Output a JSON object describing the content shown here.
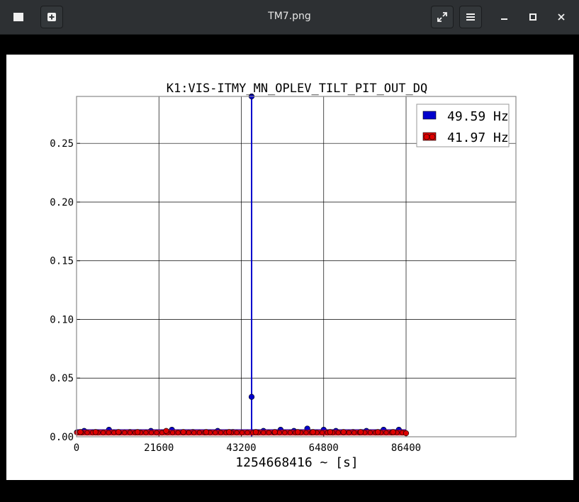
{
  "window": {
    "title": "TM7.png",
    "icons": {
      "left_1": "image-icon",
      "left_2": "add-icon",
      "fullscreen": "fullscreen-icon",
      "menu": "hamburger-menu-icon",
      "minimize": "minimize-icon",
      "maximize": "maximize-icon",
      "close": "close-icon"
    }
  },
  "chart_data": {
    "type": "scatter",
    "title": "K1:VIS-ITMY_MN_OPLEV_TILT_PIT_OUT_DQ",
    "xlabel": "1254668416 ~ [s]",
    "ylabel": "",
    "xlim": [
      0,
      115200
    ],
    "ylim": [
      0,
      0.29
    ],
    "xticks": [
      0,
      21600,
      43200,
      64800,
      86400
    ],
    "xtick_labels": [
      "0",
      "21600",
      "43200",
      "64800",
      "86400"
    ],
    "yticks": [
      0.0,
      0.05,
      0.1,
      0.15,
      0.2,
      0.25
    ],
    "ytick_labels": [
      "0.00",
      "0.05",
      "0.10",
      "0.15",
      "0.20",
      "0.25"
    ],
    "grid": true,
    "legend_position": "top-right",
    "series": [
      {
        "name": "49.59 Hz",
        "color": "#0000cc",
        "marker": "circle",
        "spike": {
          "x": 45900,
          "values": [
            0.29,
            0.034
          ]
        },
        "x_range": [
          0,
          86400
        ],
        "points": [
          [
            2000,
            0.005
          ],
          [
            8500,
            0.006
          ],
          [
            14000,
            0.004
          ],
          [
            19500,
            0.005
          ],
          [
            25000,
            0.006
          ],
          [
            30500,
            0.004
          ],
          [
            37000,
            0.005
          ],
          [
            41000,
            0.004
          ],
          [
            45900,
            0.034
          ],
          [
            45900,
            0.29
          ],
          [
            49000,
            0.005
          ],
          [
            53500,
            0.006
          ],
          [
            57000,
            0.005
          ],
          [
            60500,
            0.007
          ],
          [
            64800,
            0.006
          ],
          [
            68000,
            0.005
          ],
          [
            72500,
            0.004
          ],
          [
            76000,
            0.005
          ],
          [
            80500,
            0.006
          ],
          [
            84500,
            0.006
          ]
        ]
      },
      {
        "name": "41.97 Hz",
        "color": "#dd0000",
        "marker": "circle",
        "x_range": [
          0,
          86400
        ],
        "points": [
          [
            1000,
            0.004
          ],
          [
            5000,
            0.004
          ],
          [
            11000,
            0.004
          ],
          [
            16000,
            0.004
          ],
          [
            23500,
            0.005
          ],
          [
            28000,
            0.004
          ],
          [
            34000,
            0.004
          ],
          [
            40000,
            0.004
          ],
          [
            47000,
            0.004
          ],
          [
            52000,
            0.004
          ],
          [
            58000,
            0.004
          ],
          [
            62000,
            0.004
          ],
          [
            66500,
            0.004
          ],
          [
            70000,
            0.004
          ],
          [
            74500,
            0.004
          ],
          [
            79000,
            0.004
          ],
          [
            83000,
            0.004
          ],
          [
            86400,
            0.003
          ]
        ]
      }
    ]
  }
}
